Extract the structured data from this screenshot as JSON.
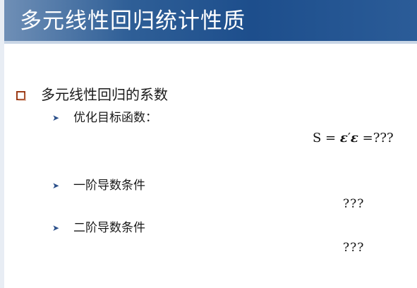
{
  "slide": {
    "title": "多元线性回归统计性质",
    "main_bullet": "多元线性回归的系数",
    "sub_items": [
      {
        "label": "优化目标函数："
      },
      {
        "label": "一阶导数条件"
      },
      {
        "label": "二阶导数条件"
      }
    ],
    "formula": {
      "lhs": "S =",
      "eps1": "ε",
      "prime": "′",
      "eps2": "ε",
      "rhs": "=???"
    },
    "answers": [
      "???",
      "???"
    ],
    "colors": {
      "title_bar": "#1d4e8c",
      "bullet": "#9c3b17",
      "arrow": "#2a4f8a"
    },
    "icons": {
      "main_bullet": "hollow-square-bullet-icon",
      "sub_bullet": "arrowhead-bullet-icon"
    }
  }
}
